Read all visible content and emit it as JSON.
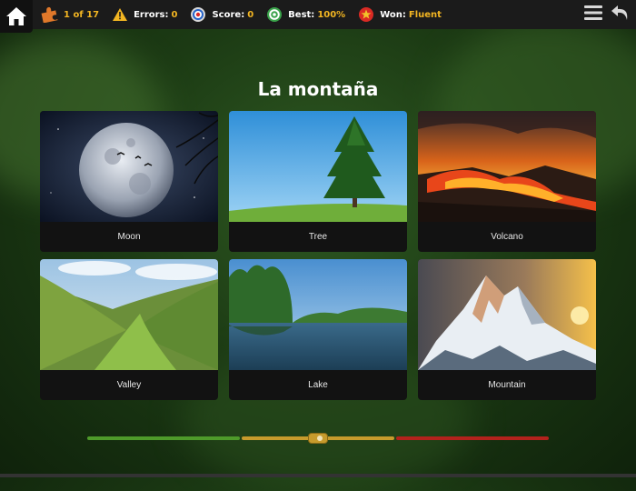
{
  "topbar": {
    "progress_value": "1 of 17",
    "errors_label": "Errors:",
    "errors_value": "0",
    "score_label": "Score:",
    "score_value": "0",
    "best_label": "Best:",
    "best_value": "100%",
    "won_label": "Won:",
    "won_value": "Fluent"
  },
  "quiz": {
    "title": "La montaña"
  },
  "cards": [
    {
      "label": "Moon"
    },
    {
      "label": "Tree"
    },
    {
      "label": "Volcano"
    },
    {
      "label": "Valley"
    },
    {
      "label": "Lake"
    },
    {
      "label": "Mountain"
    }
  ],
  "speed_slider": {
    "level_fraction": 0.5
  },
  "colors": {
    "accent": "#f2b522",
    "slider_green": "#4e9a2a",
    "slider_yellow": "#c79b2c",
    "slider_red": "#b3221c"
  }
}
